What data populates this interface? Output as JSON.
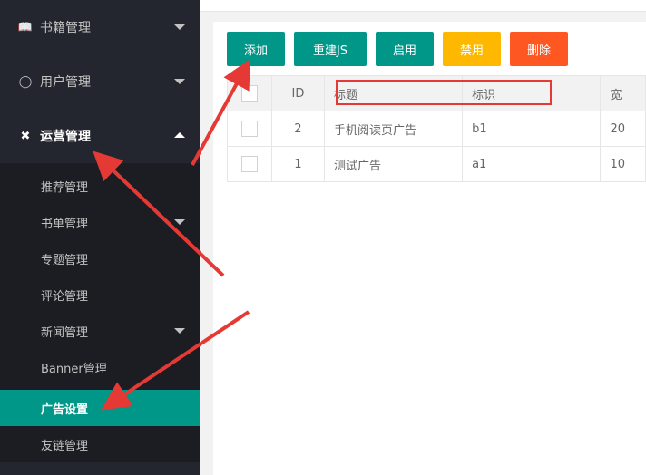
{
  "sidebar": {
    "top_items": [
      {
        "label": "书籍管理",
        "icon": "book-icon"
      },
      {
        "label": "用户管理",
        "icon": "user-icon"
      },
      {
        "label": "运营管理",
        "icon": "tools-icon"
      }
    ],
    "sub_items": [
      {
        "label": "推荐管理"
      },
      {
        "label": "书单管理"
      },
      {
        "label": "专题管理"
      },
      {
        "label": "评论管理"
      },
      {
        "label": "新闻管理"
      },
      {
        "label": "Banner管理"
      },
      {
        "label": "广告设置"
      },
      {
        "label": "友链管理"
      }
    ]
  },
  "toolbar": {
    "add_label": "添加",
    "rebuild_label": "重建JS",
    "enable_label": "启用",
    "disable_label": "禁用",
    "delete_label": "删除"
  },
  "table": {
    "headers": [
      "ID",
      "标题",
      "标识",
      "宽"
    ],
    "rows": [
      {
        "id": "2",
        "title": "手机阅读页广告",
        "key": "b1",
        "width": "20"
      },
      {
        "id": "1",
        "title": "测试广告",
        "key": "a1",
        "width": "10"
      }
    ]
  },
  "colors": {
    "sidebar": "#23262e",
    "submenu": "#1b1d23",
    "primary": "#009688",
    "warm": "#FFB800",
    "danger": "#FF5722",
    "annotation": "#e53935"
  }
}
